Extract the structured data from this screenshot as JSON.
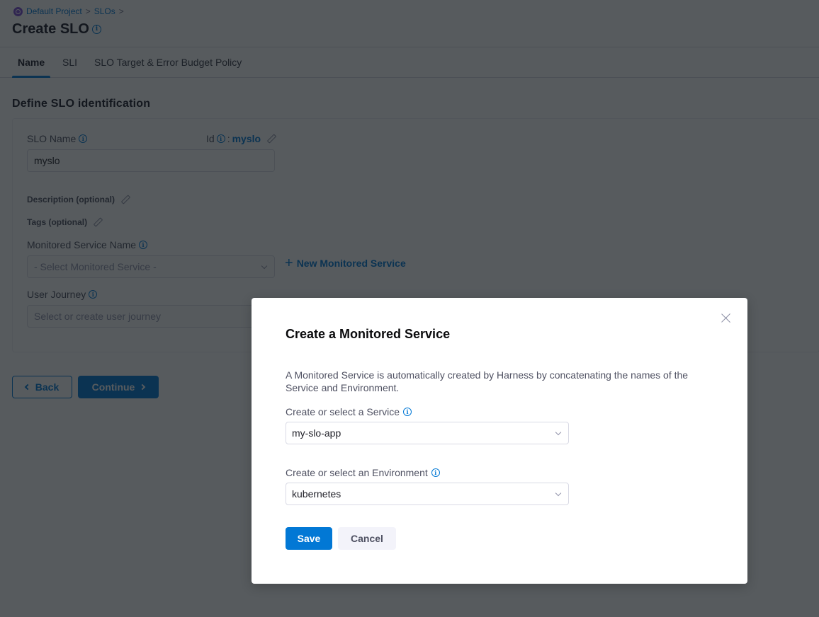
{
  "breadcrumb": {
    "items": [
      "Default Project",
      "SLOs"
    ],
    "separator": ">"
  },
  "header": {
    "title": "Create SLO"
  },
  "tabs": [
    {
      "label": "Name",
      "active": true
    },
    {
      "label": "SLI",
      "active": false
    },
    {
      "label": "SLO Target & Error Budget Policy",
      "active": false
    }
  ],
  "form": {
    "section_title": "Define SLO identification",
    "slo_name_label": "SLO Name",
    "slo_name_value": "myslo",
    "id_label": "Id",
    "id_separator": ":",
    "id_value": "myslo",
    "description_label": "Description (optional)",
    "tags_label": "Tags (optional)",
    "monitored_service_label": "Monitored Service Name",
    "monitored_service_placeholder": "- Select Monitored Service -",
    "new_monitored_service_label": "New Monitored Service",
    "user_journey_label": "User Journey",
    "user_journey_placeholder": "Select or create user journey"
  },
  "footer": {
    "back_label": "Back",
    "continue_label": "Continue"
  },
  "dialog": {
    "title": "Create a Monitored Service",
    "description": "A Monitored Service is automatically created by Harness by concatenating the names of the Service and Environment.",
    "service_label": "Create or select a Service",
    "service_value": "my-slo-app",
    "environment_label": "Create or select an Environment",
    "environment_value": "kubernetes",
    "save_label": "Save",
    "cancel_label": "Cancel"
  },
  "icons": {
    "info": "i",
    "plus": "+"
  },
  "colors": {
    "accent": "#0278d5",
    "overlay": "#585c61",
    "project_logo": "#7d4dd3"
  }
}
